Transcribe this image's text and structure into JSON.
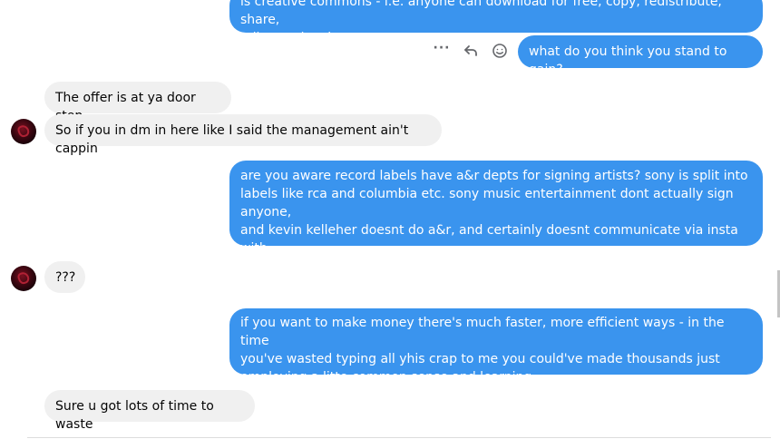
{
  "messages": {
    "m1": "is creative commons - i.e. anyone can download for free, copy, redistribute, share,\nedit, eemix, alter, etc.",
    "m2": "what do you think you stand to gain?",
    "m3": "The offer is at ya door step.",
    "m4": "So if you in dm in here like I said the management ain't cappin",
    "m5": "are you aware record labels have a&r depts for signing artists? sony is split into\nlabels like rca and columbia etc. sony music entertainment dont actually sign anyone,\nand kevin kelleher doesnt do a&r, and certainly doesnt communicate via insta with\nthe language skills of a black guy with bad grammar. do your research",
    "m6": "???",
    "m7": "if you want to make money there's much faster, more efficient ways - in the time\nyou've wasted typing all yhis crap to me you could've made thousands just\nemploying a litte common sense and learning",
    "m8": "Sure u got lots of time to waste"
  },
  "actions": {
    "more": "···",
    "more_icon": "more-icon",
    "reply_icon": "reply-icon",
    "react_icon": "smiley-icon"
  },
  "colors": {
    "outgoing_bubble": "#3a94ee",
    "incoming_bubble": "#f0f0f0",
    "icon": "#65676b"
  }
}
